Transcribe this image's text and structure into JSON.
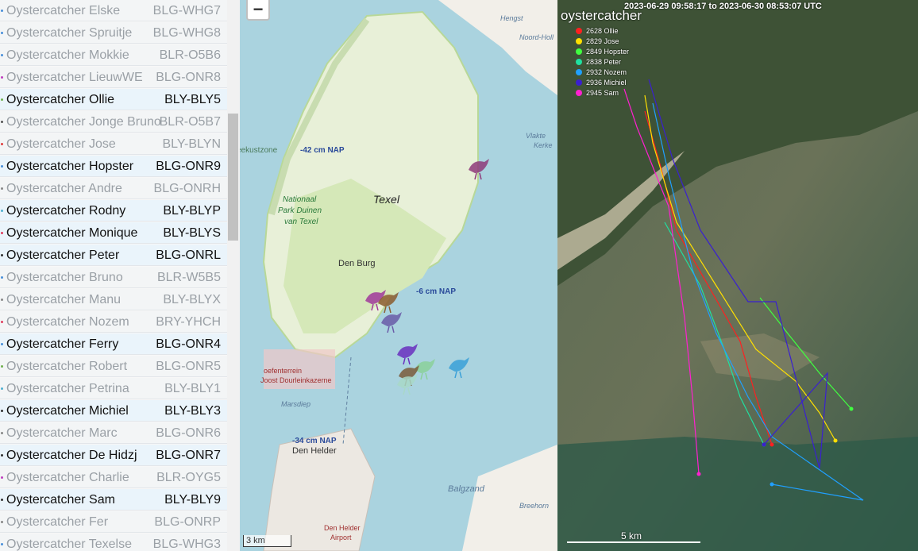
{
  "sidebar": {
    "items": [
      {
        "name": "Oystercatcher Elske",
        "code": "BLG-WHG7",
        "active": false,
        "dot_color": "#4a90d9"
      },
      {
        "name": "Oystercatcher Spruitje",
        "code": "BLG-WHG8",
        "active": false,
        "dot_color": "#4a90d9"
      },
      {
        "name": "Oystercatcher Mokkie",
        "code": "BLR-O5B6",
        "active": false,
        "dot_color": "#4a90d9"
      },
      {
        "name": "Oystercatcher LieuwWE",
        "code": "BLG-ONR8",
        "active": false,
        "dot_color": "#c040c0"
      },
      {
        "name": "Oystercatcher Ollie",
        "code": "BLY-BLY5",
        "active": true,
        "dot_color": "#70b050"
      },
      {
        "name": "Oystercatcher Jonge Bruno",
        "code": "BLR-O5B7",
        "active": false,
        "dot_color": "#555555"
      },
      {
        "name": "Oystercatcher Jose",
        "code": "BLY-BLYN",
        "active": false,
        "dot_color": "#e04040"
      },
      {
        "name": "Oystercatcher Hopster",
        "code": "BLG-ONR9",
        "active": true,
        "dot_color": "#4a90d9"
      },
      {
        "name": "Oystercatcher Andre",
        "code": "BLG-ONRH",
        "active": false,
        "dot_color": "#888888"
      },
      {
        "name": "Oystercatcher Rodny",
        "code": "BLY-BLYP",
        "active": true,
        "dot_color": "#50b0d0"
      },
      {
        "name": "Oystercatcher Monique",
        "code": "BLY-BLYS",
        "active": true,
        "dot_color": "#e04060"
      },
      {
        "name": "Oystercatcher Peter",
        "code": "BLG-ONRL",
        "active": true,
        "dot_color": "#333333"
      },
      {
        "name": "Oystercatcher Bruno",
        "code": "BLR-W5B5",
        "active": false,
        "dot_color": "#4a90d9"
      },
      {
        "name": "Oystercatcher Manu",
        "code": "BLY-BLYX",
        "active": false,
        "dot_color": "#888888"
      },
      {
        "name": "Oystercatcher Nozem",
        "code": "BRY-YHCH",
        "active": false,
        "dot_color": "#e04060"
      },
      {
        "name": "Oystercatcher Ferry",
        "code": "BLG-ONR4",
        "active": true,
        "dot_color": "#4a90d9"
      },
      {
        "name": "Oystercatcher Robert",
        "code": "BLG-ONR5",
        "active": false,
        "dot_color": "#70b050"
      },
      {
        "name": "Oystercatcher Petrina",
        "code": "BLY-BLY1",
        "active": false,
        "dot_color": "#50b0d0"
      },
      {
        "name": "Oystercatcher Michiel",
        "code": "BLY-BLY3",
        "active": true,
        "dot_color": "#333333"
      },
      {
        "name": "Oystercatcher Marc",
        "code": "BLG-ONR6",
        "active": false,
        "dot_color": "#888888"
      },
      {
        "name": "Oystercatcher De Hidzj",
        "code": "BLG-ONR7",
        "active": true,
        "dot_color": "#333333"
      },
      {
        "name": "Oystercatcher Charlie",
        "code": "BLR-OYG5",
        "active": false,
        "dot_color": "#c040c0"
      },
      {
        "name": "Oystercatcher Sam",
        "code": "BLY-BLY9",
        "active": true,
        "dot_color": "#333333"
      },
      {
        "name": "Oystercatcher Fer",
        "code": "BLG-ONRP",
        "active": false,
        "dot_color": "#888888"
      },
      {
        "name": "Oystercatcher Texelse",
        "code": "BLG-WHG3",
        "active": false,
        "dot_color": "#4a90d9"
      }
    ]
  },
  "map": {
    "zoom_out_label": "−",
    "labels": {
      "hengst": "Hengst",
      "noord_holland": "Noord-Holl",
      "kustzone": "eekustzone",
      "nap_minus42": "-42 cm NAP",
      "vlakte": "Vlakte",
      "kerke": "Kerke",
      "texel": "Texel",
      "np1": "Nationaal",
      "np2": "Park Duinen",
      "np3": "van Texel",
      "den_burg": "Den Burg",
      "nap_minus6": "-6 cm NAP",
      "oef1": "oefenterrein",
      "oef2": "Joost Dourleinkazerne",
      "marsdiep": "Marsdiep",
      "nap_minus34": "-34 cm NAP",
      "den_helder": "Den Helder",
      "balgzand": "Balgzand",
      "breehorn": "Breehorn",
      "airport1": "Den Helder",
      "airport2": "Airport"
    },
    "scale_label": "3 km",
    "bird_colors": [
      "#8e3a7a",
      "#a0389a",
      "#8b5c2e",
      "#6a5aa8",
      "#6a2fc0",
      "#3aa0d8",
      "#8bd09a",
      "#7a5a3a",
      "#a8d8c8"
    ]
  },
  "satellite": {
    "time_range": "2023-06-29 09:58:17 to 2023-06-30 08:53:07 UTC",
    "title": "oystercatcher",
    "legend": [
      {
        "label": "2628 Ollie",
        "color": "#ff2020"
      },
      {
        "label": "2829 Jose",
        "color": "#ffe000"
      },
      {
        "label": "2849 Hopster",
        "color": "#40ff40"
      },
      {
        "label": "2838 Peter",
        "color": "#20e0a0"
      },
      {
        "label": "2932 Nozem",
        "color": "#20a0ff"
      },
      {
        "label": "2936 Michiel",
        "color": "#3a20d0"
      },
      {
        "label": "2945 Sam",
        "color": "#ff20d0"
      }
    ],
    "scale_label": "5 km"
  }
}
